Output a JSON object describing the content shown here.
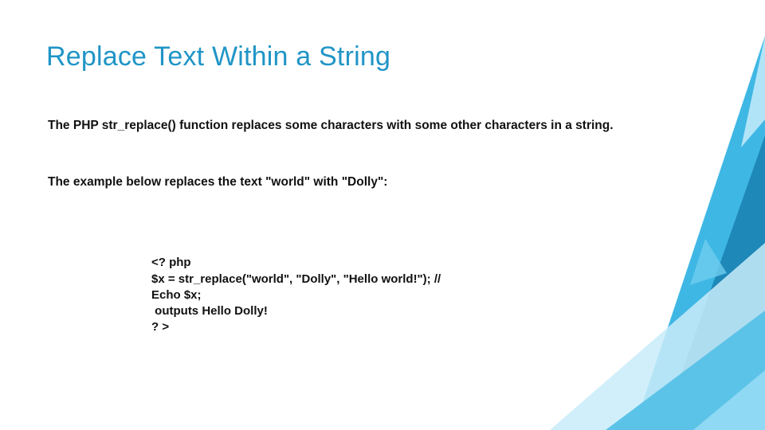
{
  "title": "Replace Text Within a String",
  "para1": "The PHP str_replace() function replaces some characters with some other characters in a string.",
  "para2": "The example below replaces the text \"world\" with \"Dolly\":",
  "code": {
    "l1": "<? php",
    "l2": "$x = str_replace(\"world\", \"Dolly\", \"Hello world!\"); //",
    "l3": "Echo $x;",
    "l4": " outputs Hello Dolly!",
    "l5": "? >"
  },
  "colors": {
    "title": "#2095c6",
    "accent_light": "#9fdaf3",
    "accent_mid": "#3fb7e4",
    "accent_dark": "#1e88b8"
  }
}
